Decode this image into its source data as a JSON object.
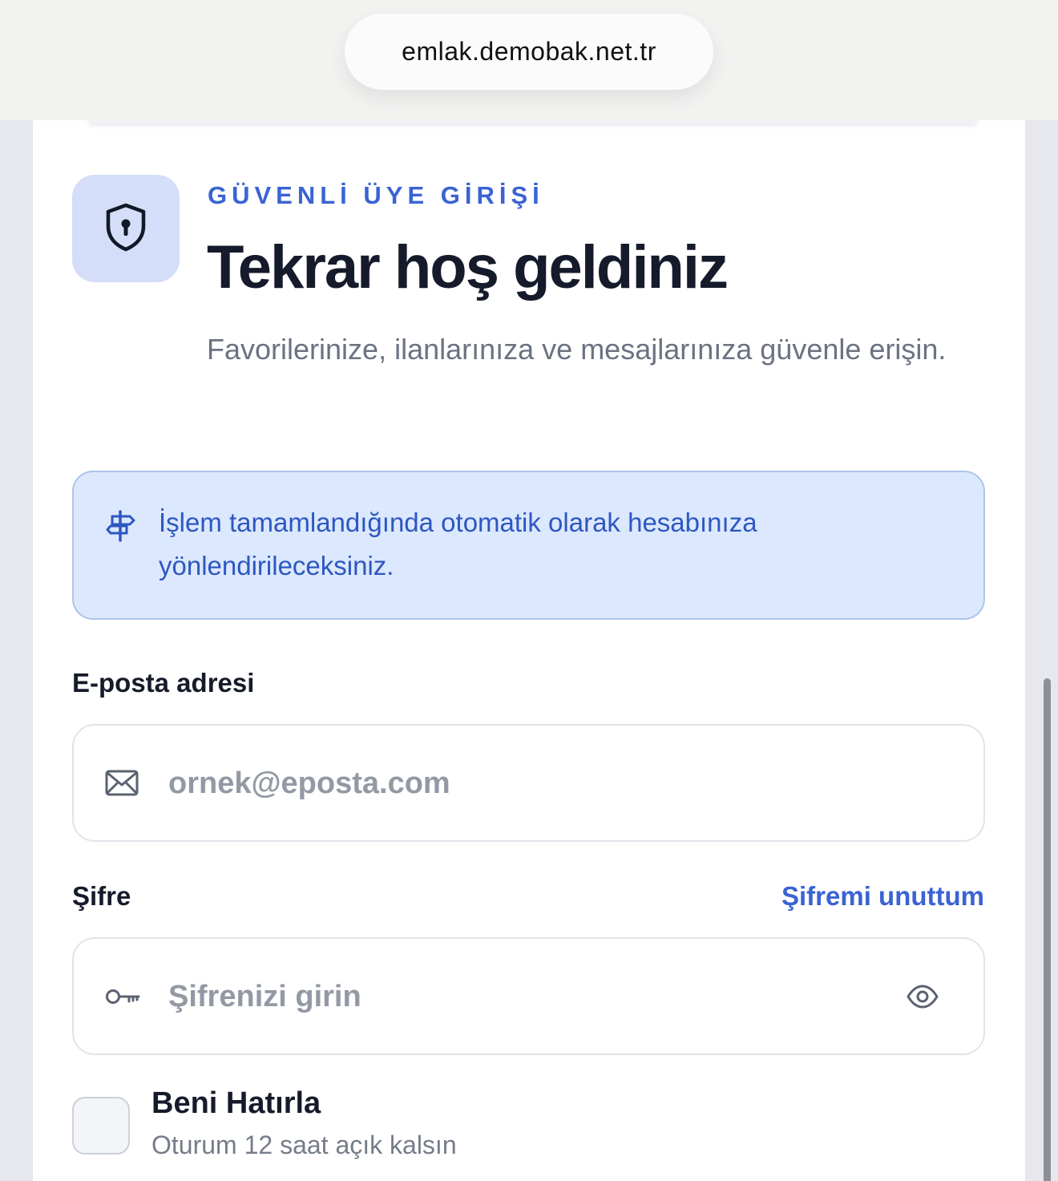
{
  "browser": {
    "url": "emlak.demobak.net.tr"
  },
  "header": {
    "badge_icon": "shield-keyhole-icon",
    "kicker": "GÜVENLİ ÜYE GİRİŞİ",
    "title": "Tekrar hoş geldiniz",
    "subtitle": "Favorilerinize, ilanlarınıza ve mesajlarınıza güvenle erişin."
  },
  "notice": {
    "icon": "signpost-icon",
    "text": "İşlem tamamlandığında otomatik olarak hesabınıza yönlendirileceksiniz."
  },
  "email": {
    "label": "E-posta adresi",
    "placeholder": "ornek@eposta.com",
    "value": "",
    "icon": "envelope-icon"
  },
  "password": {
    "label": "Şifre",
    "forgot_link": "Şifremi unuttum",
    "placeholder": "Şifrenizi girin",
    "value": "",
    "icon": "key-icon",
    "toggle_icon": "eye-icon"
  },
  "remember": {
    "label": "Beni Hatırla",
    "sublabel": "Oturum 12 saat açık kalsın",
    "checked": false
  },
  "colors": {
    "accent": "#3a63d4",
    "heading": "#161b2b",
    "notice_bg": "#dce8fd",
    "badge_bg": "#d4def8"
  }
}
